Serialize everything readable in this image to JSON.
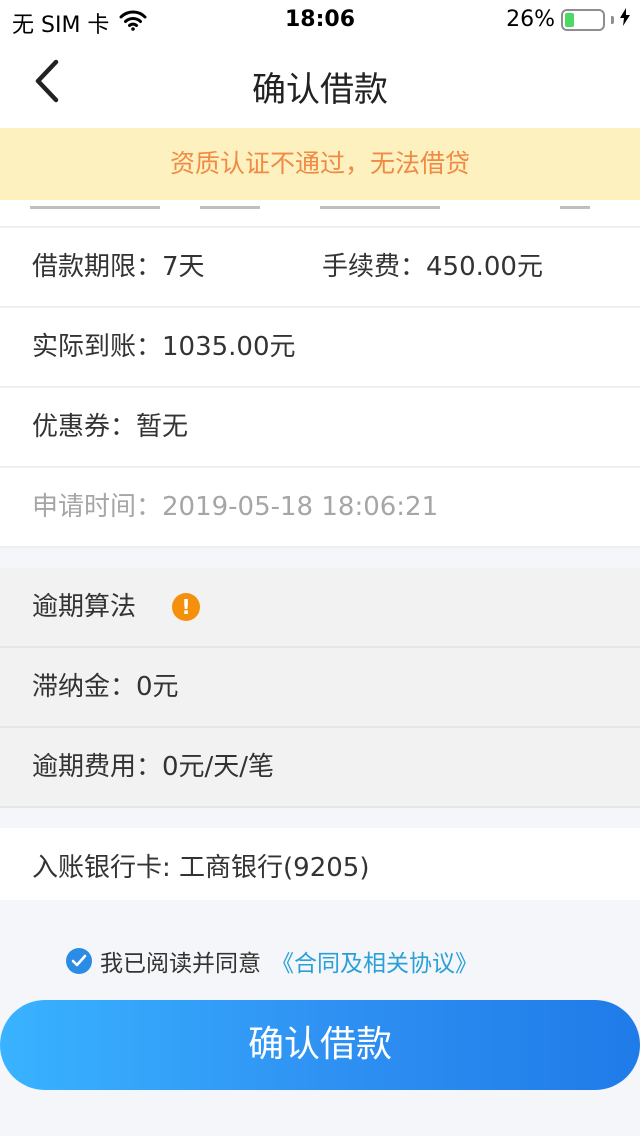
{
  "status_bar": {
    "carrier": "无 SIM 卡",
    "time": "18:06",
    "battery_text": "26%",
    "battery_level": 0.26,
    "battery_color": "#4cd964"
  },
  "nav": {
    "title": "确认借款",
    "back_icon": "chevron-left-icon"
  },
  "warning": {
    "text": "资质认证不通过，无法借贷",
    "bg_color": "#fdf1bf",
    "text_color": "#f08a44"
  },
  "loan_info": {
    "term": "借款期限：7天",
    "fee": "手续费：450.00元",
    "actual_amount": "实际到账：1035.00元",
    "coupon": "优惠券：暂无",
    "apply_time": "申请时间：2019-05-18 18:06:21"
  },
  "overdue": {
    "title": "逾期算法",
    "info_icon": "exclamation-icon",
    "late_fee": "滞纳金：0元",
    "overdue_fee": "逾期费用：0元/天/笔"
  },
  "bank": {
    "text": "入账银行卡: 工商银行(9205)"
  },
  "agreement": {
    "text": "我已阅读并同意",
    "link": "《合同及相关协议》",
    "checked": true,
    "link_color": "#2aa0d8"
  },
  "confirm_button": {
    "label": "确认借款"
  }
}
